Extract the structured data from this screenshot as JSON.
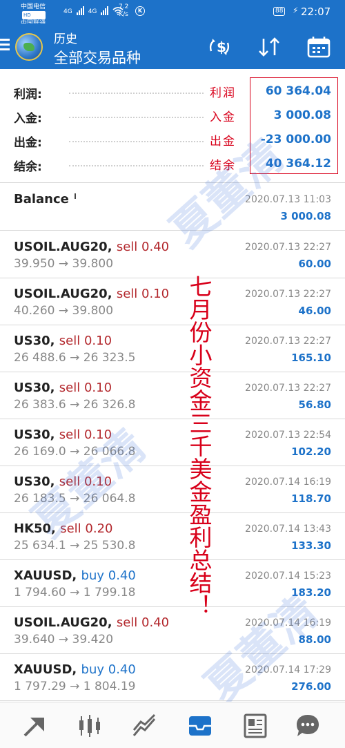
{
  "status_bar": {
    "carrier1": "中国电信",
    "carrier2": "中国联通",
    "hd": "HD",
    "net1": "4G",
    "net2": "4G",
    "speed_value": "7.2",
    "speed_unit": "K/s",
    "k_badge": "K",
    "battery": "88",
    "time": "22:07"
  },
  "header": {
    "title": "历史",
    "subtitle": "全部交易品种"
  },
  "summary": [
    {
      "label": "利润:",
      "note": "利润",
      "value": "60 364.04"
    },
    {
      "label": "入金:",
      "note": "入金",
      "value": "3 000.08"
    },
    {
      "label": "出金:",
      "note": "出金",
      "value": "-23 000.00"
    },
    {
      "label": "结余:",
      "note": "结余",
      "value": "40 364.12"
    }
  ],
  "balance_row": {
    "label": "Balance",
    "time": "2020.07.13 11:03",
    "amount": "3 000.08"
  },
  "trades": [
    {
      "symbol": "USOIL.AUG20,",
      "side": "sell",
      "volume": "0.40",
      "prices": "39.950 → 39.800",
      "time": "2020.07.13 22:27",
      "profit": "60.00"
    },
    {
      "symbol": "USOIL.AUG20,",
      "side": "sell",
      "volume": "0.10",
      "prices": "40.260 → 39.800",
      "time": "2020.07.13 22:27",
      "profit": "46.00"
    },
    {
      "symbol": "US30,",
      "side": "sell",
      "volume": "0.10",
      "prices": "26 488.6 → 26 323.5",
      "time": "2020.07.13 22:27",
      "profit": "165.10"
    },
    {
      "symbol": "US30,",
      "side": "sell",
      "volume": "0.10",
      "prices": "26 383.6 → 26 326.8",
      "time": "2020.07.13 22:27",
      "profit": "56.80"
    },
    {
      "symbol": "US30,",
      "side": "sell",
      "volume": "0.10",
      "prices": "26 169.0 → 26 066.8",
      "time": "2020.07.13 22:54",
      "profit": "102.20"
    },
    {
      "symbol": "US30,",
      "side": "sell",
      "volume": "0.10",
      "prices": "26 183.5 → 26 064.8",
      "time": "2020.07.14 16:19",
      "profit": "118.70"
    },
    {
      "symbol": "HK50,",
      "side": "sell",
      "volume": "0.20",
      "prices": "25 634.1 → 25 530.8",
      "time": "2020.07.14 13:43",
      "profit": "133.30"
    },
    {
      "symbol": "XAUUSD,",
      "side": "buy",
      "volume": "0.40",
      "prices": "1 794.60 → 1 799.18",
      "time": "2020.07.14 15:23",
      "profit": "183.20"
    },
    {
      "symbol": "USOIL.AUG20,",
      "side": "sell",
      "volume": "0.40",
      "prices": "39.640 → 39.420",
      "time": "2020.07.14 16:19",
      "profit": "88.00"
    },
    {
      "symbol": "XAUUSD,",
      "side": "buy",
      "volume": "0.40",
      "prices": "1 797.29 → 1 804.19",
      "time": "2020.07.14 17:29",
      "profit": "276.00"
    }
  ],
  "annotation": "七月份小资金三千美金盈利总结！",
  "watermark": "夏董清",
  "colors": {
    "primary": "#1d72c9",
    "sell": "#b3282d",
    "annotation": "#d8001a"
  },
  "nav_icons": [
    "trade-icon",
    "quotes-icon",
    "chart-icon",
    "history-icon",
    "news-icon",
    "chat-icon"
  ]
}
